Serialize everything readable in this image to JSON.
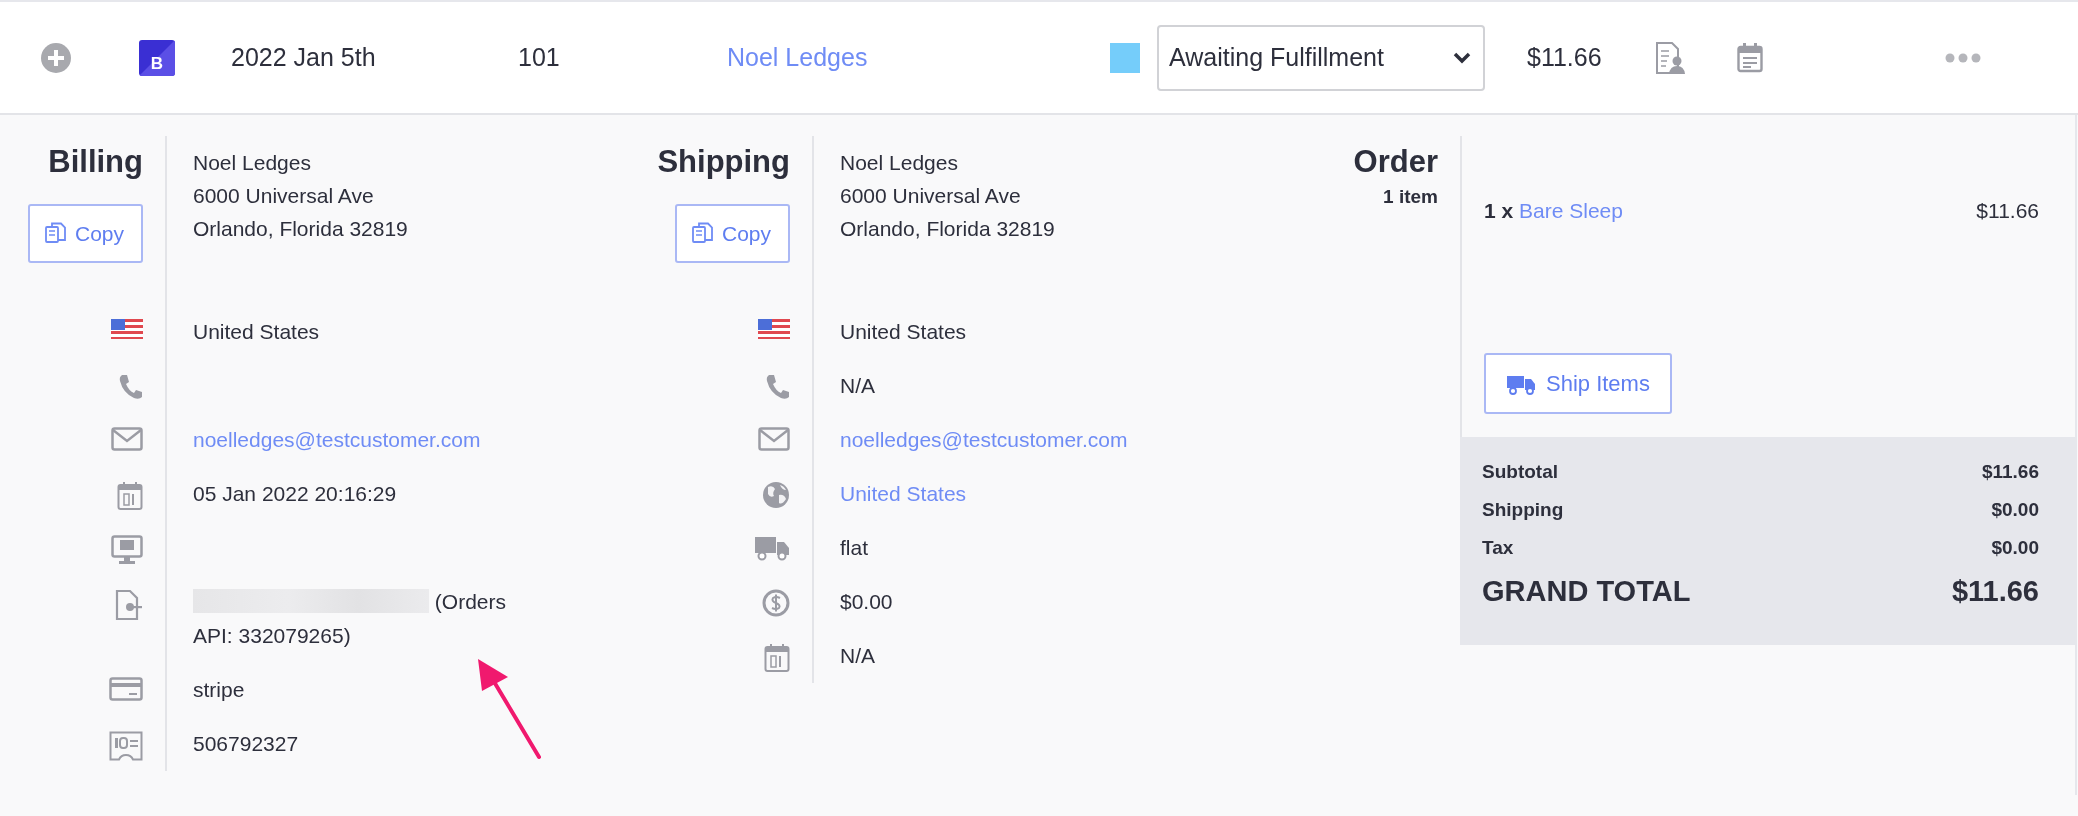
{
  "order_row": {
    "channel_badge": "B",
    "date": "2022 Jan 5th",
    "number": "101",
    "customer": "Noel Ledges",
    "status": {
      "color": "#75cdfa",
      "value": "Awaiting Fulfillment"
    },
    "total": "$11.66"
  },
  "billing": {
    "title": "Billing",
    "copy_label": "Copy",
    "address": [
      "Noel Ledges",
      "6000 Universal Ave",
      "Orlando, Florida 32819"
    ],
    "details": [
      {
        "kind": "country",
        "text": "United States"
      },
      {
        "kind": "phone"
      },
      {
        "kind": "email",
        "text": "noelledges@testcustomer.com"
      },
      {
        "kind": "date",
        "text": "05 Jan 2022 20:16:29"
      },
      {
        "kind": "ip"
      },
      {
        "kind": "source",
        "text": "(Orders API: 332079265)",
        "redacted": true
      },
      {
        "kind": "payment",
        "text": "stripe"
      },
      {
        "kind": "transaction",
        "text": "506792327"
      }
    ]
  },
  "shipping": {
    "title": "Shipping",
    "copy_label": "Copy",
    "address": [
      "Noel Ledges",
      "6000 Universal Ave",
      "Orlando, Florida 32819"
    ],
    "details": [
      {
        "kind": "country",
        "text": "United States"
      },
      {
        "kind": "phone",
        "text": "N/A"
      },
      {
        "kind": "email",
        "text": "noelledges@testcustomer.com"
      },
      {
        "kind": "region",
        "text": "United States"
      },
      {
        "kind": "method",
        "text": "flat"
      },
      {
        "kind": "cost",
        "text": "$0.00"
      },
      {
        "kind": "date",
        "text": "N/A"
      }
    ]
  },
  "order": {
    "title": "Order",
    "item_count": "1 item",
    "items": [
      {
        "quantity": "1 x",
        "name": "Bare Sleep",
        "price": "$11.66"
      }
    ],
    "ship_button": "Ship Items",
    "totals": [
      {
        "kind": "line",
        "label": "Subtotal",
        "value": "$11.66"
      },
      {
        "kind": "line",
        "label": "Shipping",
        "value": "$0.00"
      },
      {
        "kind": "line",
        "label": "Tax",
        "value": "$0.00"
      },
      {
        "kind": "grand",
        "label": "GRAND TOTAL",
        "value": "$11.66"
      }
    ]
  }
}
